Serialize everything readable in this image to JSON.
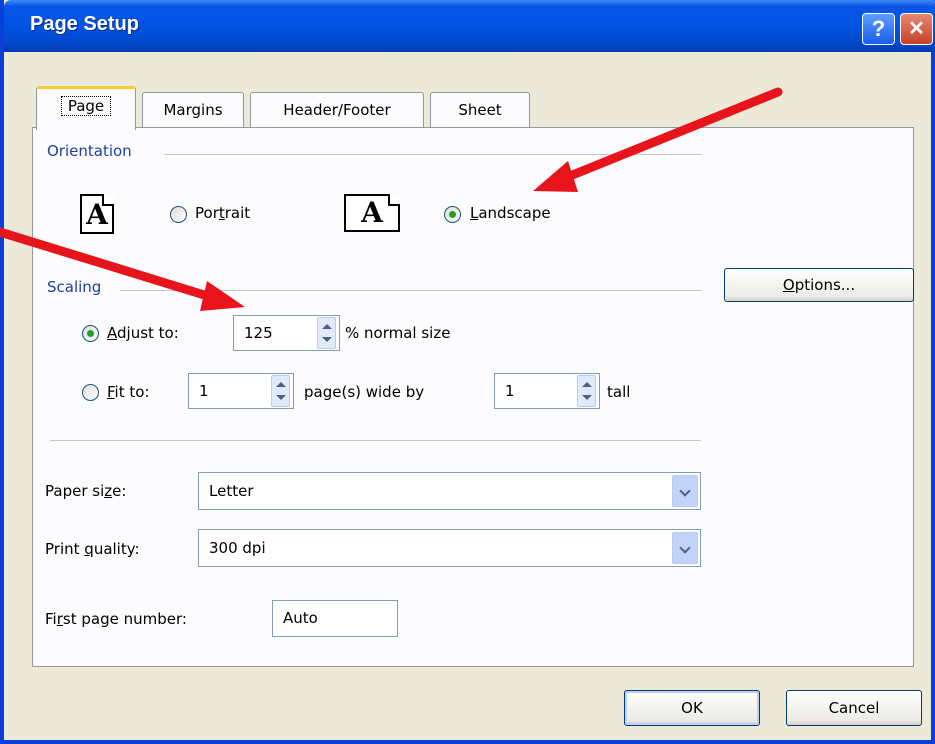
{
  "window": {
    "title": "Page Setup",
    "help_label": "?",
    "close_label": "✕"
  },
  "tabs": [
    {
      "label": "Page",
      "active": true
    },
    {
      "label": "Margins"
    },
    {
      "label": "Header/Footer"
    },
    {
      "label": "Sheet"
    }
  ],
  "orientation": {
    "group_label": "Orientation",
    "portrait_icon_letter": "A",
    "landscape_icon_letter": "A",
    "portrait": {
      "pre": "Por",
      "key": "t",
      "post": "rait",
      "selected": false
    },
    "landscape": {
      "pre": "",
      "key": "L",
      "post": "andscape",
      "selected": true
    }
  },
  "scaling": {
    "group_label": "Scaling",
    "adjust": {
      "pre": "",
      "key": "A",
      "post": "djust to:",
      "value": "125",
      "suffix": "% normal size",
      "selected": true
    },
    "fit": {
      "pre": "",
      "key": "F",
      "post": "it to:",
      "wide_value": "1",
      "wide_suffix": "page(s) wide by",
      "tall_value": "1",
      "tall_suffix": "tall",
      "selected": false
    }
  },
  "options_button": {
    "pre": "",
    "key": "O",
    "post": "ptions..."
  },
  "paper_size": {
    "label_pre": "Paper si",
    "label_key": "z",
    "label_post": "e:",
    "value": "Letter"
  },
  "print_quality": {
    "label_pre": "Print ",
    "label_key": "q",
    "label_post": "uality:",
    "value": "300 dpi"
  },
  "first_page": {
    "label_pre": "Fi",
    "label_key": "r",
    "label_post": "st page number:",
    "value": "Auto"
  },
  "footer": {
    "ok_label": "OK",
    "cancel_label": "Cancel"
  },
  "annotation_color": "#E8141B"
}
